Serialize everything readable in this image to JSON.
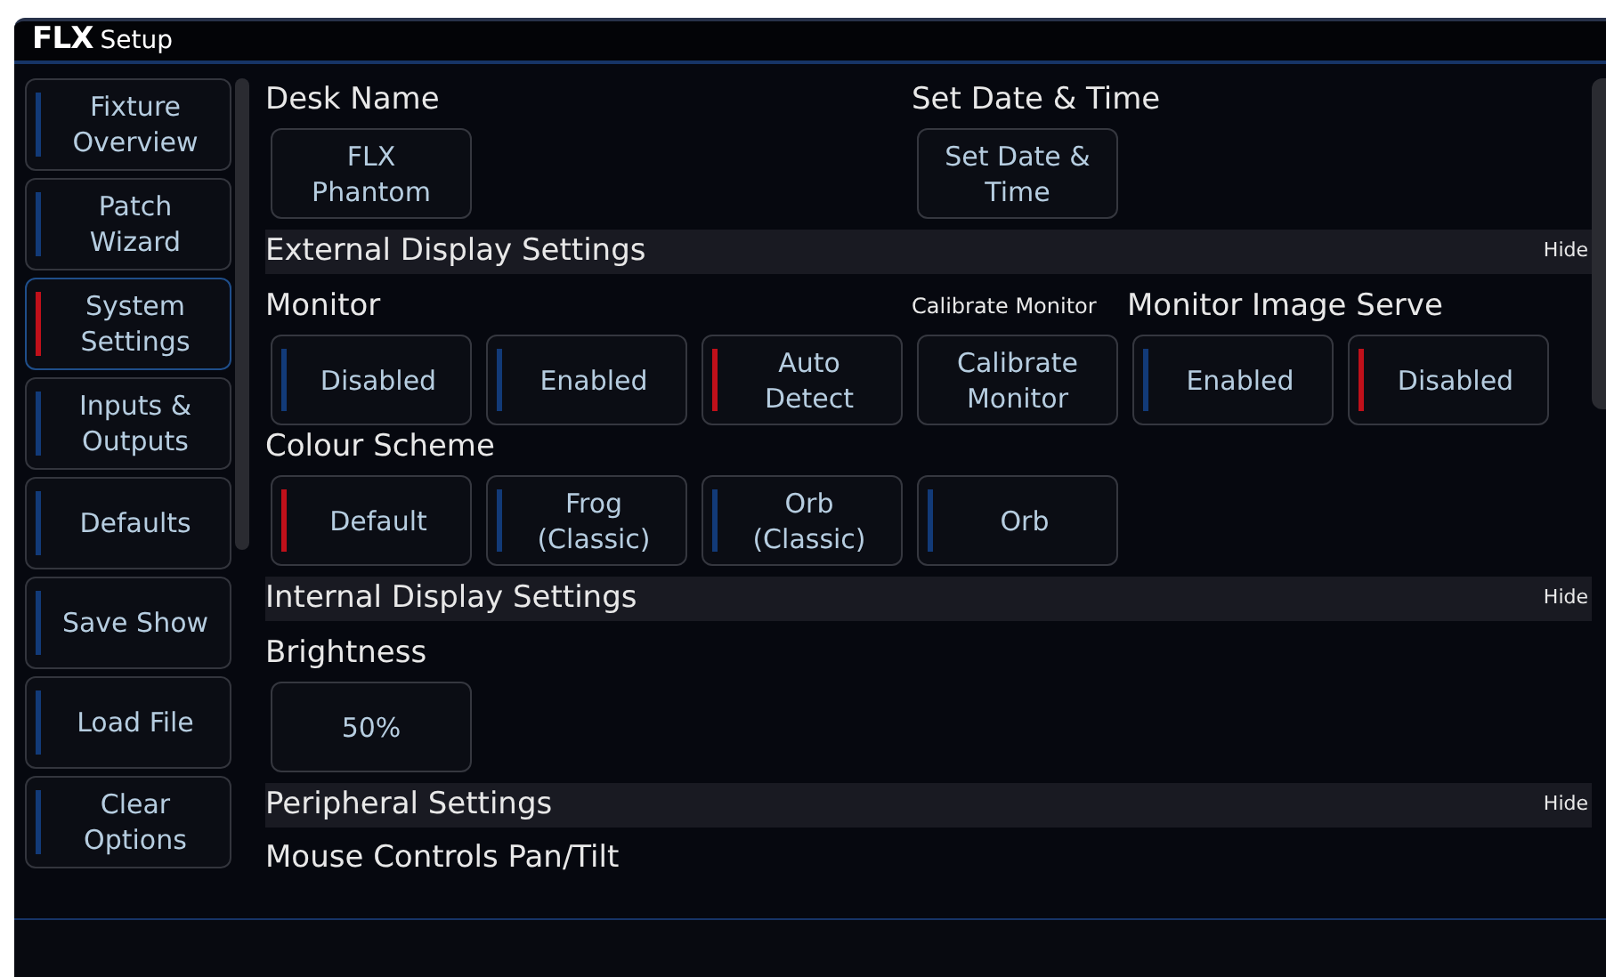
{
  "window": {
    "logo": "FLX",
    "title": "Setup"
  },
  "sidebar": {
    "items": [
      {
        "label": "Fixture\nOverview",
        "selected": false
      },
      {
        "label": "Patch\nWizard",
        "selected": false
      },
      {
        "label": "System\nSettings",
        "selected": true
      },
      {
        "label": "Inputs &\nOutputs",
        "selected": false
      },
      {
        "label": "Defaults",
        "selected": false
      },
      {
        "label": "Save Show",
        "selected": false
      },
      {
        "label": "Load File",
        "selected": false
      },
      {
        "label": "Clear\nOptions",
        "selected": false
      }
    ]
  },
  "content": [
    {
      "kind": "row",
      "groups": [
        {
          "label": "Desk Name",
          "buttons": [
            {
              "kind": "action",
              "label": "FLX\nPhantom"
            }
          ]
        },
        {
          "label": "Set Date & Time",
          "buttons": [
            {
              "kind": "action",
              "label": "Set Date &\nTime"
            }
          ]
        }
      ]
    },
    {
      "kind": "header",
      "title": "External Display Settings",
      "toggle": "Hide"
    },
    {
      "kind": "row",
      "groups": [
        {
          "label": "Monitor",
          "buttons": [
            {
              "kind": "option",
              "label": "Disabled",
              "selected": false
            },
            {
              "kind": "option",
              "label": "Enabled",
              "selected": false
            },
            {
              "kind": "option",
              "label": "Auto\nDetect",
              "selected": true
            }
          ]
        },
        {
          "label": "Calibrate Monitor",
          "buttons": [
            {
              "kind": "action",
              "label": "Calibrate\nMonitor"
            }
          ]
        },
        {
          "label": "Monitor Image Serve",
          "buttons": [
            {
              "kind": "option",
              "label": "Enabled",
              "selected": false
            },
            {
              "kind": "option",
              "label": "Disabled",
              "selected": true
            }
          ]
        }
      ]
    },
    {
      "kind": "row",
      "groups": [
        {
          "label": "Colour Scheme",
          "buttons": [
            {
              "kind": "option",
              "label": "Default",
              "selected": true
            },
            {
              "kind": "option",
              "label": "Frog\n(Classic)",
              "selected": false
            },
            {
              "kind": "option",
              "label": "Orb\n(Classic)",
              "selected": false
            },
            {
              "kind": "option",
              "label": "Orb",
              "selected": false
            }
          ]
        }
      ]
    },
    {
      "kind": "header",
      "title": "Internal Display Settings",
      "toggle": "Hide"
    },
    {
      "kind": "row",
      "groups": [
        {
          "label": "Brightness",
          "buttons": [
            {
              "kind": "action",
              "label": "50%"
            }
          ]
        }
      ]
    },
    {
      "kind": "header",
      "title": "Peripheral Settings",
      "toggle": "Hide"
    },
    {
      "kind": "label",
      "text": "Mouse Controls Pan/Tilt"
    }
  ]
}
